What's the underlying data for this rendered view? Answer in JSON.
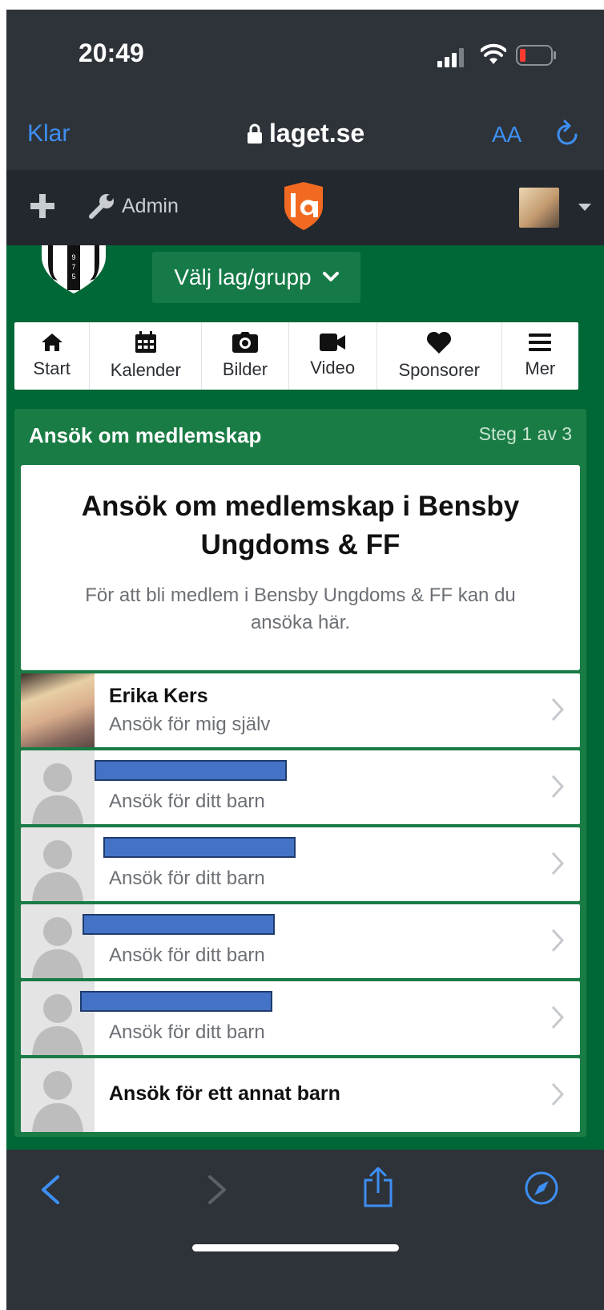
{
  "status": {
    "time": "20:49"
  },
  "browser": {
    "done_label": "Klar",
    "url": "laget.se",
    "text_size_label": "AA"
  },
  "app_header": {
    "admin_label": "Admin",
    "logo_text": "la"
  },
  "team": {
    "select_label": "Välj lag/grupp"
  },
  "nav": [
    {
      "label": "Start",
      "icon": "home-icon"
    },
    {
      "label": "Kalender",
      "icon": "calendar-icon"
    },
    {
      "label": "Bilder",
      "icon": "camera-icon"
    },
    {
      "label": "Video",
      "icon": "video-icon"
    },
    {
      "label": "Sponsorer",
      "icon": "heart-icon"
    },
    {
      "label": "Mer",
      "icon": "menu-icon"
    }
  ],
  "membership": {
    "panel_title": "Ansök om medlemskap",
    "step": "Steg 1 av 3",
    "heading": "Ansök om medlemskap i Bensby Ungdoms & FF",
    "description": "För att bli medlem i Bensby Ungdoms & FF kan du ansöka här.",
    "rows": [
      {
        "name": "Erika Kers",
        "sub": "Ansök för mig själv"
      },
      {
        "name": "",
        "sub": "Ansök för ditt barn"
      },
      {
        "name": "",
        "sub": "Ansök för ditt barn"
      },
      {
        "name": "",
        "sub": "Ansök för ditt barn"
      },
      {
        "name": "",
        "sub": "Ansök för ditt barn"
      },
      {
        "name": "Ansök för ett annat barn",
        "sub": ""
      }
    ]
  },
  "colors": {
    "accent": "#3d8ff3",
    "green": "#006837",
    "panel_green": "#1a7c45",
    "logo": "#f26a21"
  }
}
